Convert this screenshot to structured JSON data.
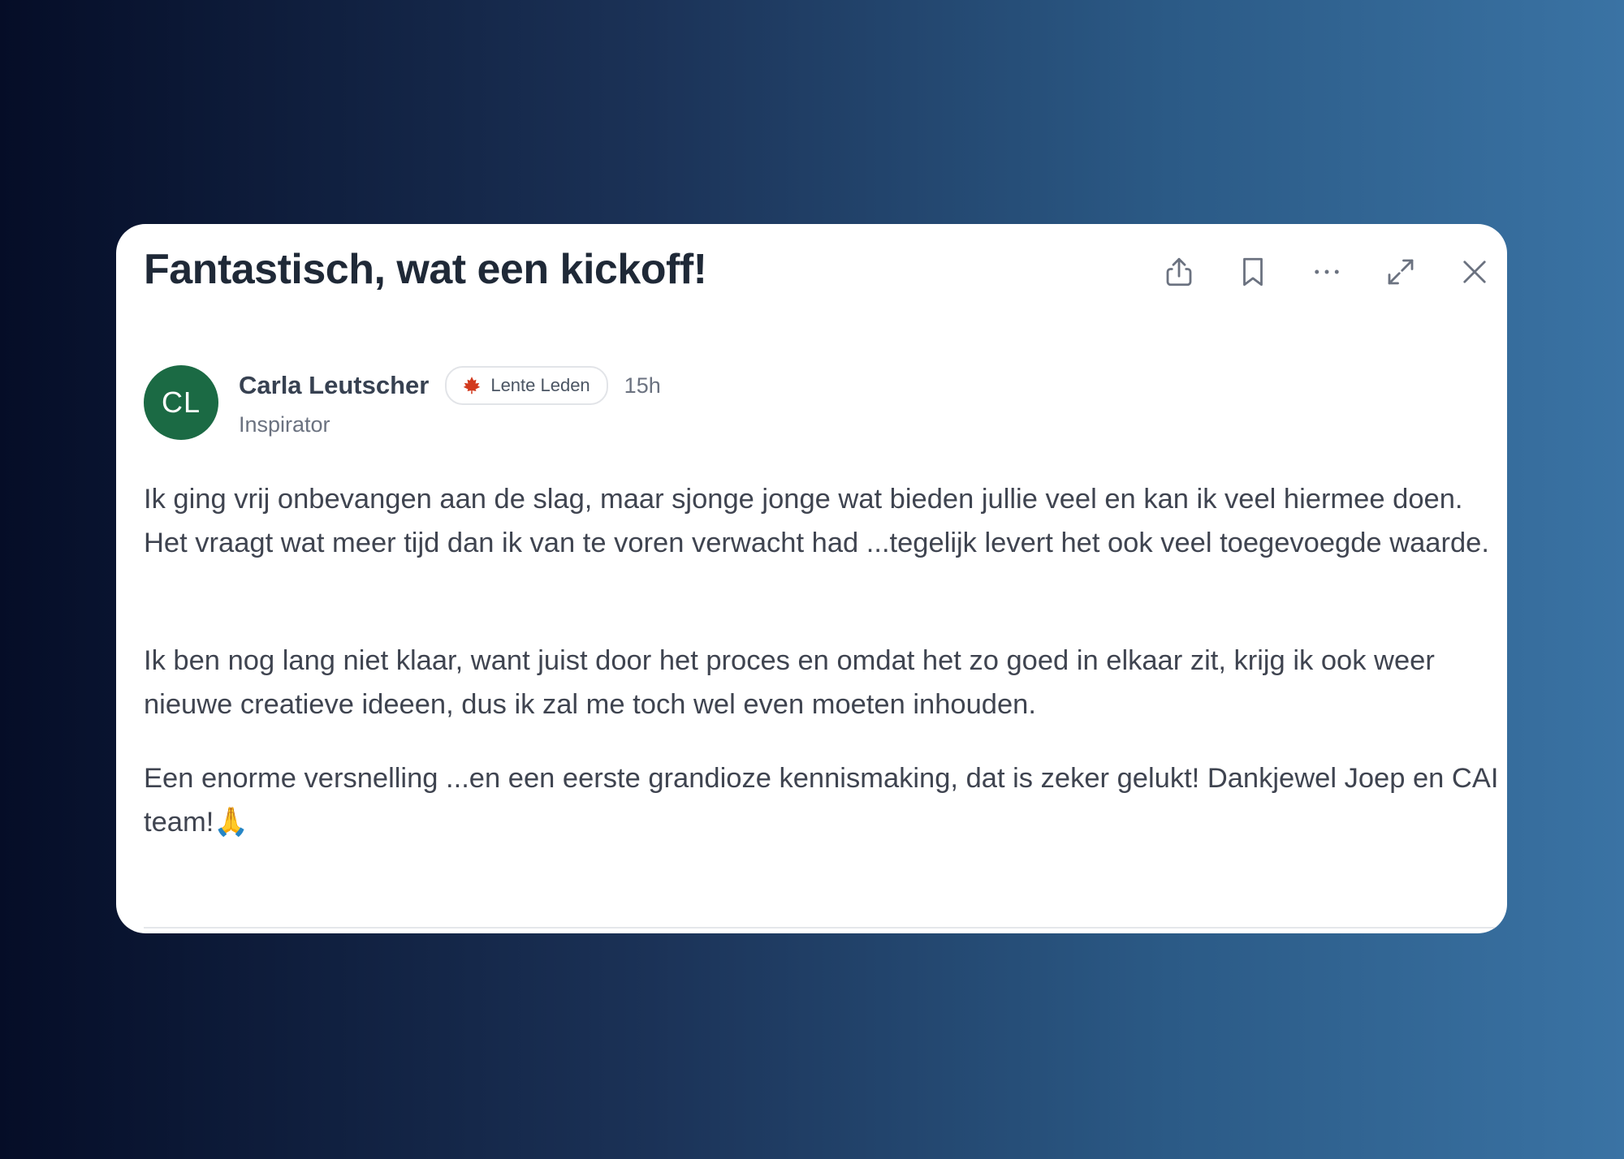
{
  "post": {
    "title": "Fantastisch, wat een kickoff!",
    "author": {
      "initials": "CL",
      "name": "Carla Leutscher",
      "role": "Inspirator",
      "avatar_color": "#1b6a44"
    },
    "badge": {
      "icon": "maple-leaf-icon",
      "label": "Lente Leden"
    },
    "timestamp": "15h",
    "paragraphs": [
      "Ik ging vrij onbevangen aan de slag, maar sjonge jonge wat bieden jullie veel en kan ik veel hiermee doen. Het vraagt wat meer tijd dan ik van te voren verwacht had ...tegelijk levert het ook veel toegevoegde waarde.",
      "Ik ben nog lang niet klaar, want juist door het proces en omdat het zo goed in elkaar zit, krijg ik ook weer nieuwe creatieve ideeen, dus ik zal me toch wel even moeten inhouden.",
      "Een enorme versnelling ...en een eerste grandioze kennismaking, dat is zeker gelukt! Dankjewel Joep en CAI team!"
    ],
    "closing_emoji": "🙏"
  },
  "toolbar": {
    "icons": [
      "share-icon",
      "bookmark-icon",
      "more-icon",
      "expand-icon",
      "close-icon"
    ]
  },
  "colors": {
    "background_gradient": [
      "#050d27",
      "#3a73a4"
    ],
    "card": "#ffffff",
    "title": "#1f2937",
    "body_text": "#3f4450"
  }
}
